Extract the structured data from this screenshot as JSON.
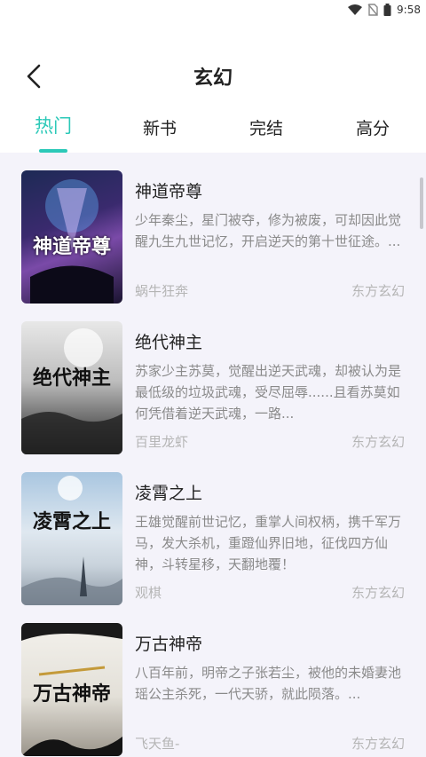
{
  "status": {
    "time": "9:58"
  },
  "header": {
    "title": "玄幻"
  },
  "tabs": [
    {
      "label": "热门",
      "active": true
    },
    {
      "label": "新书",
      "active": false
    },
    {
      "label": "完结",
      "active": false
    },
    {
      "label": "高分",
      "active": false
    }
  ],
  "accent_color": "#2cc9b8",
  "books": [
    {
      "title": "神道帝尊",
      "description": "少年秦尘，星门被夺，修为被废，可却因此觉醒九生九世记忆，开启逆天的第十世征途。...",
      "author": "蜗牛狂奔",
      "category": "东方玄幻",
      "cover_text": "神道帝尊"
    },
    {
      "title": "绝代神主",
      "description": "苏家少主苏莫，觉醒出逆天武魂，却被认为是最低级的垃圾武魂，受尽屈辱......且看苏莫如何凭借着逆天武魂，一路...",
      "author": "百里龙虾",
      "category": "东方玄幻",
      "cover_text": "绝代神主"
    },
    {
      "title": "凌霄之上",
      "description": "王雄觉醒前世记忆，重掌人间权柄，携千军万马，发大杀机，重蹬仙界旧地，征伐四方仙神，斗转星移，天翻地覆！",
      "author": "观棋",
      "category": "东方玄幻",
      "cover_text": "凌霄之上"
    },
    {
      "title": "万古神帝",
      "description": "八百年前，明帝之子张若尘，被他的未婚妻池瑶公主杀死，一代天骄，就此陨落。...",
      "author": "飞天鱼-",
      "category": "东方玄幻",
      "cover_text": "万古神帝"
    }
  ]
}
